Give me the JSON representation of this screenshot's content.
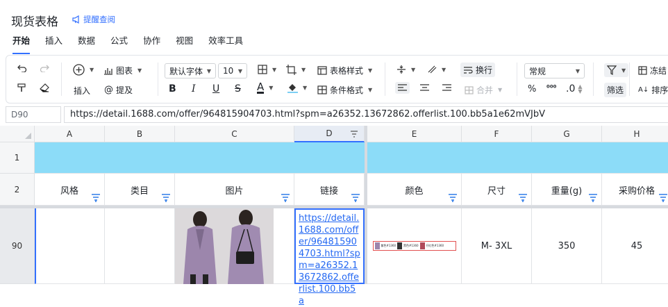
{
  "app": {
    "title": "现货表格",
    "remind_label": "提醒查阅"
  },
  "menus": [
    "开始",
    "插入",
    "数据",
    "公式",
    "协作",
    "视图",
    "效率工具"
  ],
  "toolbar": {
    "insert_label": "插入",
    "mention_label": "提及",
    "chart_label": "图表",
    "font_family": "默认字体",
    "font_size": "10",
    "table_style_label": "表格样式",
    "cond_format_label": "条件格式",
    "wrap_label": "换行",
    "merge_label": "合并",
    "number_format": "常规",
    "percent": "%",
    "thousands": "⁰⁰⁰",
    "decimal": ".0",
    "filter_label": "筛选",
    "freeze_label": "冻结",
    "sort_label": "排序"
  },
  "formula": {
    "cell_ref": "D90",
    "value": "https://detail.1688.com/offer/964815904703.html?spm=a26352.13672862.offerlist.100.bb5a1e62mVJbV"
  },
  "columns": [
    "A",
    "B",
    "C",
    "D",
    "E",
    "F",
    "G",
    "H"
  ],
  "rows": {
    "r1": "1",
    "r2": "2",
    "r90": "90"
  },
  "headers": {
    "style": "风格",
    "category": "类目",
    "image": "图片",
    "link": "链接",
    "color": "颜色",
    "size": "尺寸",
    "weight": "重量(g)",
    "price": "采购价格"
  },
  "row90": {
    "link": "https://detail.1688.com/offer/964815904703.html?spm=a26352.13672862.offerlist.100.bb5a",
    "colors": [
      "紫色#1360",
      "黑色#1360",
      "仔红色#1360"
    ],
    "size": "M- 3XL",
    "weight": "350",
    "price": "45"
  },
  "colors": {
    "accent": "#3370ff",
    "header_band": "#8cdcf8",
    "selected_border": "#3370ff"
  }
}
